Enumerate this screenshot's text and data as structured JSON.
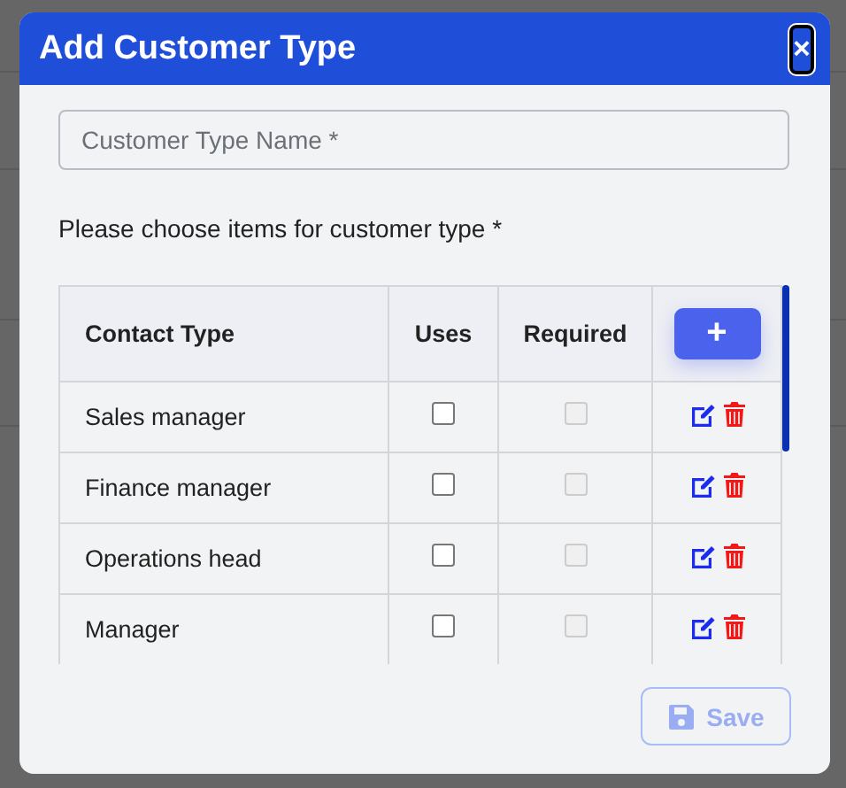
{
  "dialog": {
    "title": "Add Customer Type",
    "close_label": "×"
  },
  "name_field": {
    "placeholder": "Customer Type Name *"
  },
  "prompt": "Please choose items for customer type *",
  "table": {
    "columns": [
      "Contact Type",
      "Uses",
      "Required"
    ],
    "add_label": "+",
    "rows": [
      {
        "contact_type": "Sales manager",
        "uses": false,
        "required": false,
        "required_disabled": true
      },
      {
        "contact_type": "Finance manager",
        "uses": false,
        "required": false,
        "required_disabled": true
      },
      {
        "contact_type": "Operations head",
        "uses": false,
        "required": false,
        "required_disabled": true
      },
      {
        "contact_type": "Manager",
        "uses": false,
        "required": false,
        "required_disabled": true
      }
    ]
  },
  "save_button": {
    "label": "Save",
    "disabled": true
  }
}
